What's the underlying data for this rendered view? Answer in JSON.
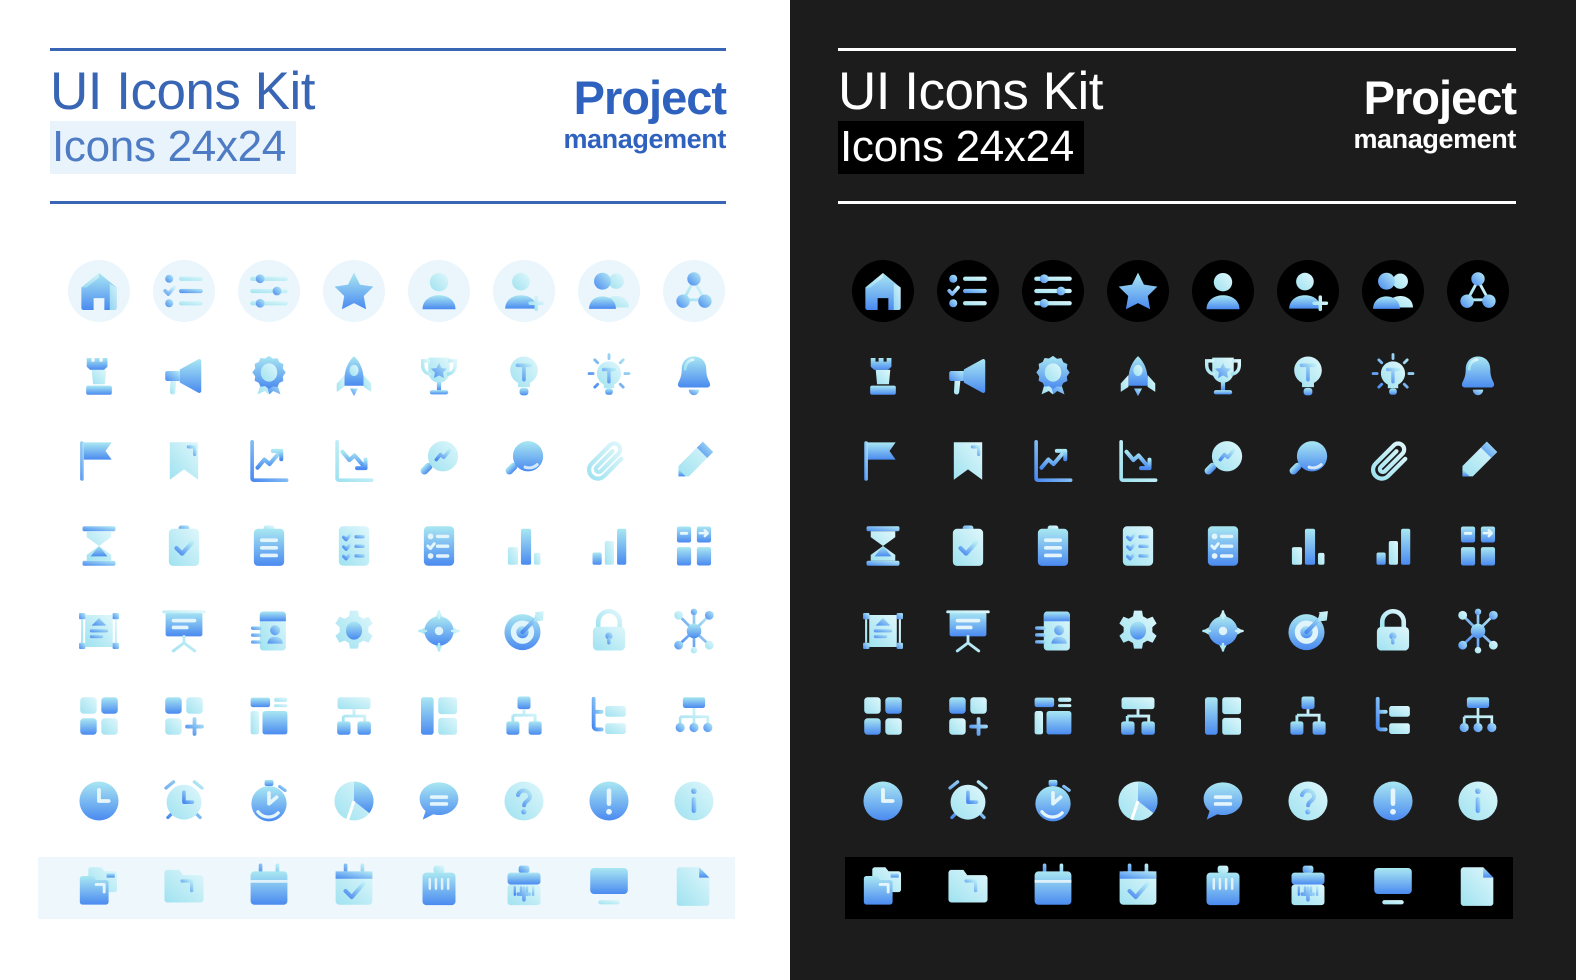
{
  "panels": [
    {
      "theme": "light",
      "title_main": "UI Icons Kit",
      "title_sub": "Icons 24x24",
      "brand_line1": "Project",
      "brand_line2": "management"
    },
    {
      "theme": "dark",
      "title_main": "UI Icons Kit",
      "title_sub": "Icons 24x24",
      "brand_line1": "Project",
      "brand_line2": "management"
    }
  ],
  "colors": {
    "light_bg": "#ffffff",
    "dark_bg": "#1c1c1c",
    "accent_blue": "#2f62bf",
    "title_blue": "#3866b5",
    "subtitle_highlight_light": "#e9f3fb",
    "subtitle_highlight_dark": "#000000",
    "disc_light": "#eaf6fb",
    "disc_dark": "#000000",
    "band_light": "#eef7fc",
    "band_dark": "#000000",
    "gradient_from": "#a9e7f2",
    "gradient_to": "#4a8af0"
  },
  "grid": {
    "columns": 8,
    "rows": 8,
    "icon_size": "24x24"
  },
  "icons": [
    {
      "name": "home-icon",
      "row": 1,
      "col": 1,
      "circled": true
    },
    {
      "name": "checklist-icon",
      "row": 1,
      "col": 2,
      "circled": true
    },
    {
      "name": "sliders-icon",
      "row": 1,
      "col": 3,
      "circled": true
    },
    {
      "name": "star-icon",
      "row": 1,
      "col": 4,
      "circled": true
    },
    {
      "name": "user-icon",
      "row": 1,
      "col": 5,
      "circled": true
    },
    {
      "name": "user-add-icon",
      "row": 1,
      "col": 6,
      "circled": true
    },
    {
      "name": "users-group-icon",
      "row": 1,
      "col": 7,
      "circled": true
    },
    {
      "name": "network-nodes-icon",
      "row": 1,
      "col": 8,
      "circled": true
    },
    {
      "name": "chess-rook-icon",
      "row": 2,
      "col": 1,
      "circled": false
    },
    {
      "name": "megaphone-icon",
      "row": 2,
      "col": 2,
      "circled": false
    },
    {
      "name": "award-badge-icon",
      "row": 2,
      "col": 3,
      "circled": false
    },
    {
      "name": "rocket-icon",
      "row": 2,
      "col": 4,
      "circled": false
    },
    {
      "name": "trophy-icon",
      "row": 2,
      "col": 5,
      "circled": false
    },
    {
      "name": "lightbulb-icon",
      "row": 2,
      "col": 6,
      "circled": false
    },
    {
      "name": "lightbulb-idea-icon",
      "row": 2,
      "col": 7,
      "circled": false
    },
    {
      "name": "bell-icon",
      "row": 2,
      "col": 8,
      "circled": false
    },
    {
      "name": "flag-icon",
      "row": 3,
      "col": 1,
      "circled": false
    },
    {
      "name": "bookmark-icon",
      "row": 3,
      "col": 2,
      "circled": false
    },
    {
      "name": "chart-up-icon",
      "row": 3,
      "col": 3,
      "circled": false
    },
    {
      "name": "chart-down-icon",
      "row": 3,
      "col": 4,
      "circled": false
    },
    {
      "name": "search-analytics-icon",
      "row": 3,
      "col": 5,
      "circled": false
    },
    {
      "name": "search-icon",
      "row": 3,
      "col": 6,
      "circled": false
    },
    {
      "name": "paperclip-icon",
      "row": 3,
      "col": 7,
      "circled": false
    },
    {
      "name": "pencil-edit-icon",
      "row": 3,
      "col": 8,
      "circled": false
    },
    {
      "name": "hourglass-icon",
      "row": 4,
      "col": 1,
      "circled": false
    },
    {
      "name": "clipboard-check-icon",
      "row": 4,
      "col": 2,
      "circled": false
    },
    {
      "name": "clipboard-lines-icon",
      "row": 4,
      "col": 3,
      "circled": false
    },
    {
      "name": "checklist-page-icon",
      "row": 4,
      "col": 4,
      "circled": false
    },
    {
      "name": "task-list-icon",
      "row": 4,
      "col": 5,
      "circled": false
    },
    {
      "name": "bar-chart-icon",
      "row": 4,
      "col": 6,
      "circled": false
    },
    {
      "name": "bar-chart-rise-icon",
      "row": 4,
      "col": 7,
      "circled": false
    },
    {
      "name": "kanban-board-icon",
      "row": 4,
      "col": 8,
      "circled": false
    },
    {
      "name": "scale-document-icon",
      "row": 5,
      "col": 1,
      "circled": false
    },
    {
      "name": "presentation-icon",
      "row": 5,
      "col": 2,
      "circled": false
    },
    {
      "name": "contact-book-icon",
      "row": 5,
      "col": 3,
      "circled": false
    },
    {
      "name": "gear-settings-icon",
      "row": 5,
      "col": 4,
      "circled": false
    },
    {
      "name": "crosshair-icon",
      "row": 5,
      "col": 5,
      "circled": false
    },
    {
      "name": "target-dart-icon",
      "row": 5,
      "col": 6,
      "circled": false
    },
    {
      "name": "lock-icon",
      "row": 5,
      "col": 7,
      "circled": false
    },
    {
      "name": "molecule-network-icon",
      "row": 5,
      "col": 8,
      "circled": false
    },
    {
      "name": "dashboard-grid-icon",
      "row": 6,
      "col": 1,
      "circled": false
    },
    {
      "name": "add-widget-icon",
      "row": 6,
      "col": 2,
      "circled": false
    },
    {
      "name": "layout-blocks-icon",
      "row": 6,
      "col": 3,
      "circled": false
    },
    {
      "name": "org-chart-icon",
      "row": 6,
      "col": 4,
      "circled": false
    },
    {
      "name": "columns-layout-icon",
      "row": 6,
      "col": 5,
      "circled": false
    },
    {
      "name": "hierarchy-icon",
      "row": 6,
      "col": 6,
      "circled": false
    },
    {
      "name": "tree-view-icon",
      "row": 6,
      "col": 7,
      "circled": false
    },
    {
      "name": "sitemap-icon",
      "row": 6,
      "col": 8,
      "circled": false
    },
    {
      "name": "clock-icon",
      "row": 7,
      "col": 1,
      "circled": false
    },
    {
      "name": "alarm-clock-icon",
      "row": 7,
      "col": 2,
      "circled": false
    },
    {
      "name": "stopwatch-icon",
      "row": 7,
      "col": 3,
      "circled": false
    },
    {
      "name": "pie-chart-icon",
      "row": 7,
      "col": 4,
      "circled": false
    },
    {
      "name": "chat-bubble-icon",
      "row": 7,
      "col": 5,
      "circled": false
    },
    {
      "name": "help-question-icon",
      "row": 7,
      "col": 6,
      "circled": false
    },
    {
      "name": "alert-exclamation-icon",
      "row": 7,
      "col": 7,
      "circled": false
    },
    {
      "name": "info-icon",
      "row": 7,
      "col": 8,
      "circled": false
    },
    {
      "name": "folders-copy-icon",
      "row": 8,
      "col": 1,
      "circled": false
    },
    {
      "name": "folder-icon",
      "row": 8,
      "col": 2,
      "circled": false
    },
    {
      "name": "calendar-icon",
      "row": 8,
      "col": 3,
      "circled": false
    },
    {
      "name": "calendar-check-icon",
      "row": 8,
      "col": 4,
      "circled": false
    },
    {
      "name": "briefcase-icon",
      "row": 8,
      "col": 5,
      "circled": false
    },
    {
      "name": "briefcase-add-icon",
      "row": 8,
      "col": 6,
      "circled": false
    },
    {
      "name": "monitor-icon",
      "row": 8,
      "col": 7,
      "circled": false
    },
    {
      "name": "file-document-icon",
      "row": 8,
      "col": 8,
      "circled": false
    }
  ]
}
